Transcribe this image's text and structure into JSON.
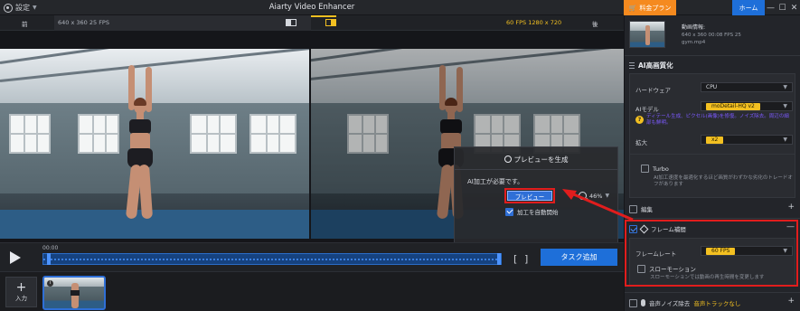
{
  "titlebar": {
    "settings_label": "設定",
    "app_title": "Aiarty Video Enhancer",
    "pricing_label": "料金プラン",
    "home_label": "ホーム",
    "minimize": "—",
    "maximize": "☐",
    "close": "✕"
  },
  "preview_header": {
    "before_label": "前",
    "after_label": "後",
    "source_info": "640 x 360  25 FPS",
    "output_info": "60 FPS  1280 x 720"
  },
  "dialog": {
    "title": "プレビューを生成",
    "message": "AI加工が必要です。",
    "preview_button": "プレビュー",
    "auto_start_label": "加工を自動開始"
  },
  "zoom": {
    "value": "46%"
  },
  "timeline": {
    "time": "00:00",
    "bracket_in": "[",
    "bracket_out": "]",
    "task_add_label": "タスク追加"
  },
  "bottom": {
    "add_label": "入力",
    "add_plus": "+",
    "thumb_badge": "i"
  },
  "panel": {
    "video_info": {
      "title": "動画情報:",
      "line1": "640 x 360  00:08  FPS 25",
      "line2": "gym.mp4"
    },
    "ai_section_title": "AI高画質化",
    "hardware_label": "ハードウェア",
    "hardware_value": "CPU",
    "model_label": "AIモデル",
    "model_value": "moDetail-HQ  v2",
    "model_warning": "ディテール生成、ピクセル(画像)を修復。ノイズ除去。周辺の細部も鮮明。",
    "model_warning_icon": "?",
    "scale_label": "拡大",
    "scale_value": "x2",
    "turbo_label": "Turbo",
    "turbo_desc": "AI加工速度を最適化するほど画質がわずかな劣化のトレードオフがあります",
    "edit_label": "編集",
    "frame_section_label": "フレーム補間",
    "frame_rate_label": "フレームレート",
    "frame_rate_value": "60 FPS",
    "slow_motion_label": "スローモーション",
    "slow_motion_desc": "スローモーションでは動画の再生時間を変更します",
    "noise_label": "音声ノイズ除去",
    "noise_value": "音声トラックなし",
    "plus": "+",
    "minus": "—"
  },
  "colors": {
    "accent_blue": "#1e6fd9",
    "accent_orange": "#f58a1f",
    "accent_yellow": "#f3c021",
    "highlight_red": "#e11d1d"
  }
}
